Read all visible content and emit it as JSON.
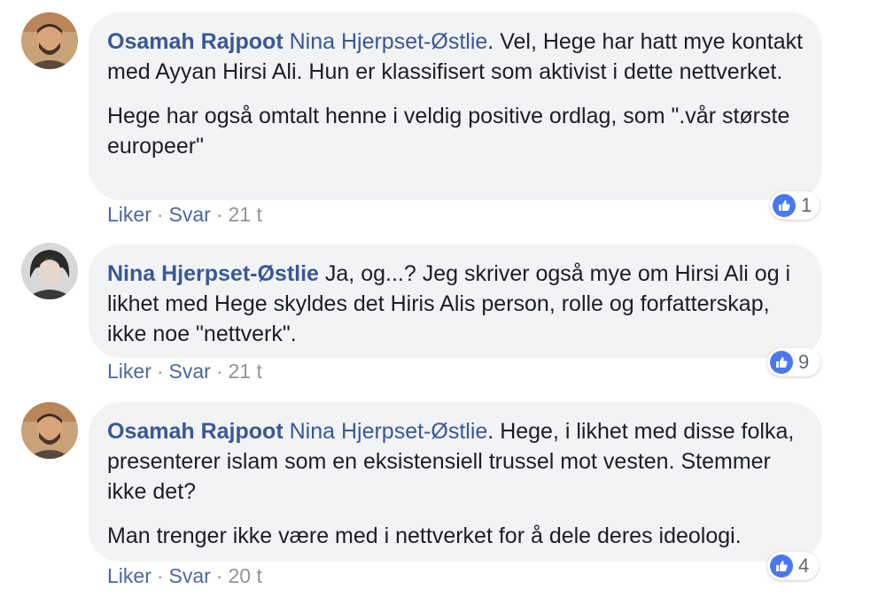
{
  "colors": {
    "name_link": "#385898",
    "text": "#1c1e21",
    "bubble_bg": "#f2f3f5",
    "meta": "#90949c",
    "like_blue": "#4a78f5"
  },
  "comments": [
    {
      "avatar_icon": "profile-photo-icon",
      "author": "Osamah Rajpoot",
      "mention": "Nina Hjerpset-Østlie",
      "paragraphs": [
        ". Vel, Hege har hatt mye kontakt med Ayyan Hirsi Ali. Hun er klassifisert som aktivist i dette nettverket.",
        "Hege har også omtalt henne i veldig positive ordlag, som \".vår største europeer\""
      ],
      "like_label": "Liker",
      "reply_label": "Svar",
      "time": "21 t",
      "reaction_icon": "like-icon",
      "reaction_count": "1"
    },
    {
      "avatar_icon": "profile-photo-icon",
      "author": "Nina Hjerpset-Østlie",
      "mention": "",
      "paragraphs": [
        " Ja, og...? Jeg skriver også mye om Hirsi Ali og i likhet med Hege skyldes det Hiris Alis person, rolle og forfatterskap, ikke noe \"nettverk\"."
      ],
      "like_label": "Liker",
      "reply_label": "Svar",
      "time": "21 t",
      "reaction_icon": "like-icon",
      "reaction_count": "9"
    },
    {
      "avatar_icon": "profile-photo-icon",
      "author": "Osamah Rajpoot",
      "mention": "Nina Hjerpset-Østlie",
      "paragraphs": [
        ". Hege, i likhet med disse folka, presenterer islam som en eksistensiell trussel mot vesten. Stemmer ikke det?",
        "Man trenger ikke være med i nettverket for å dele deres ideologi."
      ],
      "like_label": "Liker",
      "reply_label": "Svar",
      "time": "20 t",
      "reaction_icon": "like-icon",
      "reaction_count": "4"
    }
  ]
}
